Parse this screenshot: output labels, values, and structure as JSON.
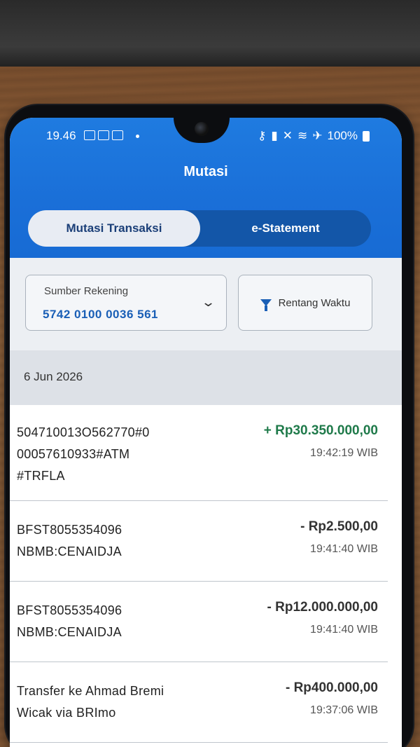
{
  "status_bar": {
    "time": "19.46",
    "battery": "100%"
  },
  "header": {
    "title": "Mutasi"
  },
  "tabs": [
    {
      "label": "Mutasi Transaksi",
      "active": true
    },
    {
      "label": "e-Statement",
      "active": false
    }
  ],
  "filters": {
    "source_label": "Sumber Rekening",
    "source_value": "5742 0100 0036 561",
    "range_label": "Rentang Waktu"
  },
  "date_header": "6 Jun 2026",
  "transactions": [
    {
      "description": "504710013O562770#0\n00057610933#ATM\n#TRFLA",
      "amount": "+ Rp30.350.000,00",
      "time": "19:42:19 WIB",
      "type": "credit"
    },
    {
      "description": "BFST8055354096\nNBMB:CENAIDJA",
      "amount": "- Rp2.500,00",
      "time": "19:41:40 WIB",
      "type": "debit"
    },
    {
      "description": "BFST8055354096\nNBMB:CENAIDJA",
      "amount": "- Rp12.000.000,00",
      "time": "19:41:40 WIB",
      "type": "debit"
    },
    {
      "description": "Transfer ke Ahmad Bremi\nWicak via BRImo",
      "amount": "- Rp400.000,00",
      "time": "19:37:06 WIB",
      "type": "debit"
    }
  ],
  "colors": {
    "primary_blue": "#1f7be0",
    "tab_bg": "#1356a8",
    "credit_green": "#1f7a4a",
    "account_blue": "#1a5fb6"
  },
  "icons": [
    "sim-icon",
    "key-icon",
    "battery-saver-icon",
    "mute-icon",
    "wifi-icon",
    "airplane-icon",
    "battery-icon",
    "chevron-down-icon",
    "filter-icon"
  ]
}
